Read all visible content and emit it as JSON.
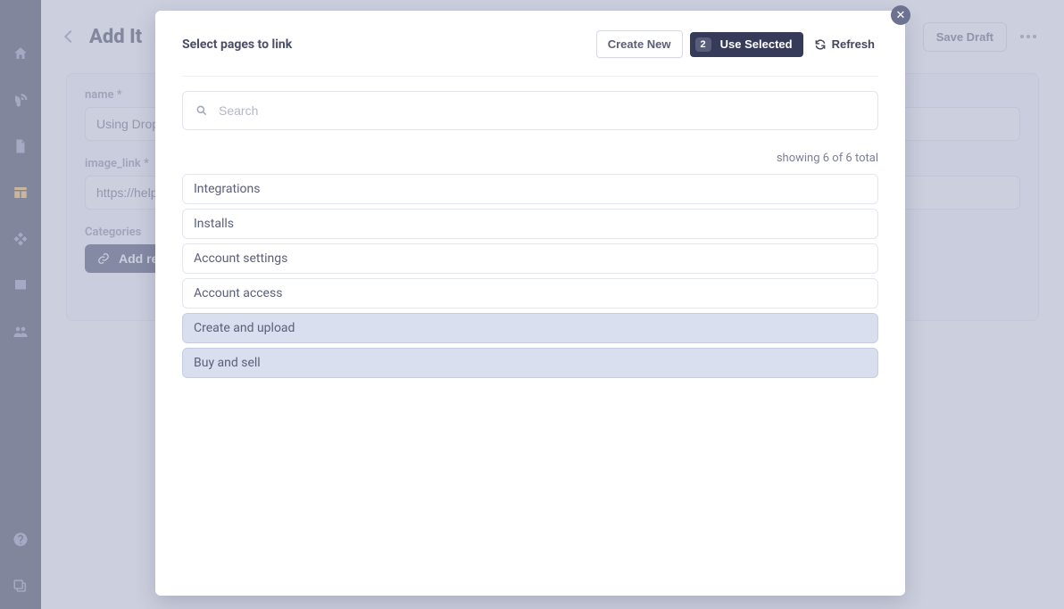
{
  "sidebar": {
    "icons": [
      "home",
      "blog",
      "page",
      "data",
      "components",
      "media",
      "users"
    ],
    "active_index": 3,
    "bottom_icons": [
      "help",
      "docs"
    ]
  },
  "page": {
    "back_aria": "Back",
    "title": "Add It",
    "save_draft_label": "Save Draft",
    "more_aria": "More options"
  },
  "form": {
    "name_label": "name *",
    "name_value": "Using Dropb",
    "image_link_label": "image_link *",
    "image_link_value": "https://help.",
    "categories_label": "Categories",
    "add_reference_label": "Add refer"
  },
  "modal": {
    "title": "Select pages to link",
    "create_new_label": "Create New",
    "selected_count": "2",
    "use_selected_label": "Use Selected",
    "refresh_label": "Refresh",
    "close_aria": "Close",
    "search_placeholder": "Search",
    "result_count_text": "showing 6 of 6 total",
    "items": [
      {
        "label": "Integrations",
        "selected": false
      },
      {
        "label": "Installs",
        "selected": false
      },
      {
        "label": "Account settings",
        "selected": false
      },
      {
        "label": "Account access",
        "selected": false
      },
      {
        "label": "Create and upload",
        "selected": true
      },
      {
        "label": "Buy and sell",
        "selected": true
      }
    ]
  }
}
